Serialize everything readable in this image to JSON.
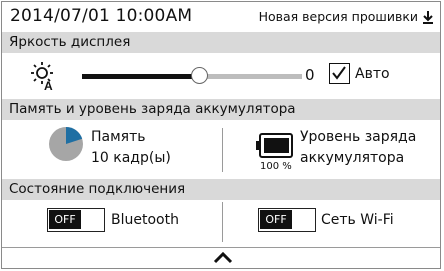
{
  "header": {
    "datetime": "2014/07/01  10:00AM",
    "firmware_notice": "Новая версия прошивки"
  },
  "brightness": {
    "title": "Яркость дисплея",
    "level": 0,
    "slider_fraction": 0.53,
    "value_text": "0",
    "auto_checked": true,
    "auto_label": "Авто"
  },
  "memory_battery": {
    "title": "Память и уровень заряда аккумулятора",
    "memory_label": "Память",
    "memory_value": "10 кадр(ы)",
    "memory_used_fraction": 0.2,
    "battery_label_line1": "Уровень заряда",
    "battery_label_line2": "аккумулятора",
    "battery_percent": "100 %"
  },
  "connection": {
    "title": "Состояние подключения",
    "bluetooth": {
      "state": "OFF",
      "label": "Bluetooth"
    },
    "wifi": {
      "state": "OFF",
      "label": "Сеть Wi-Fi"
    }
  },
  "icons": {
    "download": "download-icon",
    "brightness": "brightness-auto-icon",
    "checkbox": "checkmark-icon",
    "memory": "pie-chart-icon",
    "battery": "battery-icon",
    "collapse": "chevron-up-icon"
  },
  "colors": {
    "section_bg": "#d9d9d9",
    "pie_used": "#1f6fa3",
    "pie_free": "#a6a6a6"
  }
}
